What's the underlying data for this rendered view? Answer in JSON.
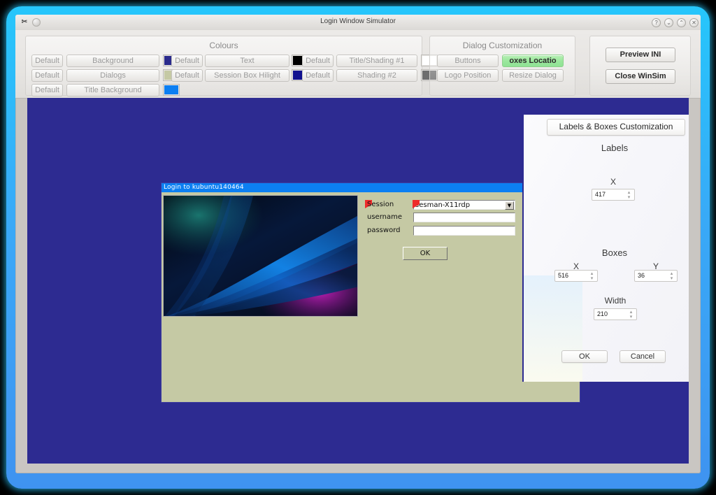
{
  "window": {
    "title": "Login Window Simulator",
    "app_icon": "scissors-icon",
    "globe_icon": "globe-icon",
    "controls": [
      {
        "name": "help-button",
        "glyph": "?"
      },
      {
        "name": "minimize-button",
        "glyph": "⌄"
      },
      {
        "name": "maximize-button",
        "glyph": "⌃"
      },
      {
        "name": "close-button",
        "glyph": "✕"
      }
    ]
  },
  "toolbar": {
    "colours": {
      "title": "Colours",
      "rows": [
        {
          "default_label": "Default",
          "name": "Background",
          "colour": "#2a2a8c"
        },
        {
          "default_label": "Default",
          "name": "Dialogs",
          "colour": "#c5c9a4"
        },
        {
          "default_label": "Default",
          "name": "Title Background",
          "colour": "#0c7ff2"
        },
        {
          "default_label": "Default",
          "name": "Text",
          "colour": "#000000"
        },
        {
          "default_label": "Default",
          "name": "Session Box Hilight",
          "colour": "#11118f"
        },
        {
          "default_label": "Default",
          "name": "Title/Shading #1",
          "colour": "#ffffff"
        },
        {
          "default_label": "Default",
          "name": "Shading #2",
          "colour": "#6e6e6e"
        }
      ]
    },
    "dialog_customization": {
      "title": "Dialog Customization",
      "buttons": [
        {
          "label": "Buttons",
          "active": false
        },
        {
          "label": "oxes Locatio",
          "active": true
        },
        {
          "label": "Logo Position",
          "active": false
        },
        {
          "label": "Resize Dialog",
          "active": false
        }
      ]
    },
    "actions": {
      "preview_label": "Preview INI",
      "close_label": "Close WinSim"
    }
  },
  "desktop": {
    "background_colour": "#2d2b91"
  },
  "login_dialog": {
    "title": "Login to kubuntu140464",
    "logo_name": "kubuntu-wallpaper-logo",
    "fields": [
      {
        "label": "Session",
        "type": "combo",
        "value": "sesman-X11rdp",
        "marker": true
      },
      {
        "label": "username",
        "type": "text",
        "value": "",
        "marker": false
      },
      {
        "label": "password",
        "type": "text",
        "value": "",
        "marker": false
      }
    ],
    "ok_label": "OK"
  },
  "side_panel": {
    "header": "Labels & Boxes Customization",
    "labels_section": {
      "title": "Labels",
      "fields": [
        {
          "label": "X",
          "value": "417"
        }
      ]
    },
    "boxes_section": {
      "title": "Boxes",
      "fields": [
        {
          "label": "X",
          "value": "516"
        },
        {
          "label": "Y",
          "value": "36"
        },
        {
          "label": "Width",
          "value": "210"
        }
      ]
    },
    "ok_label": "OK",
    "cancel_label": "Cancel"
  }
}
